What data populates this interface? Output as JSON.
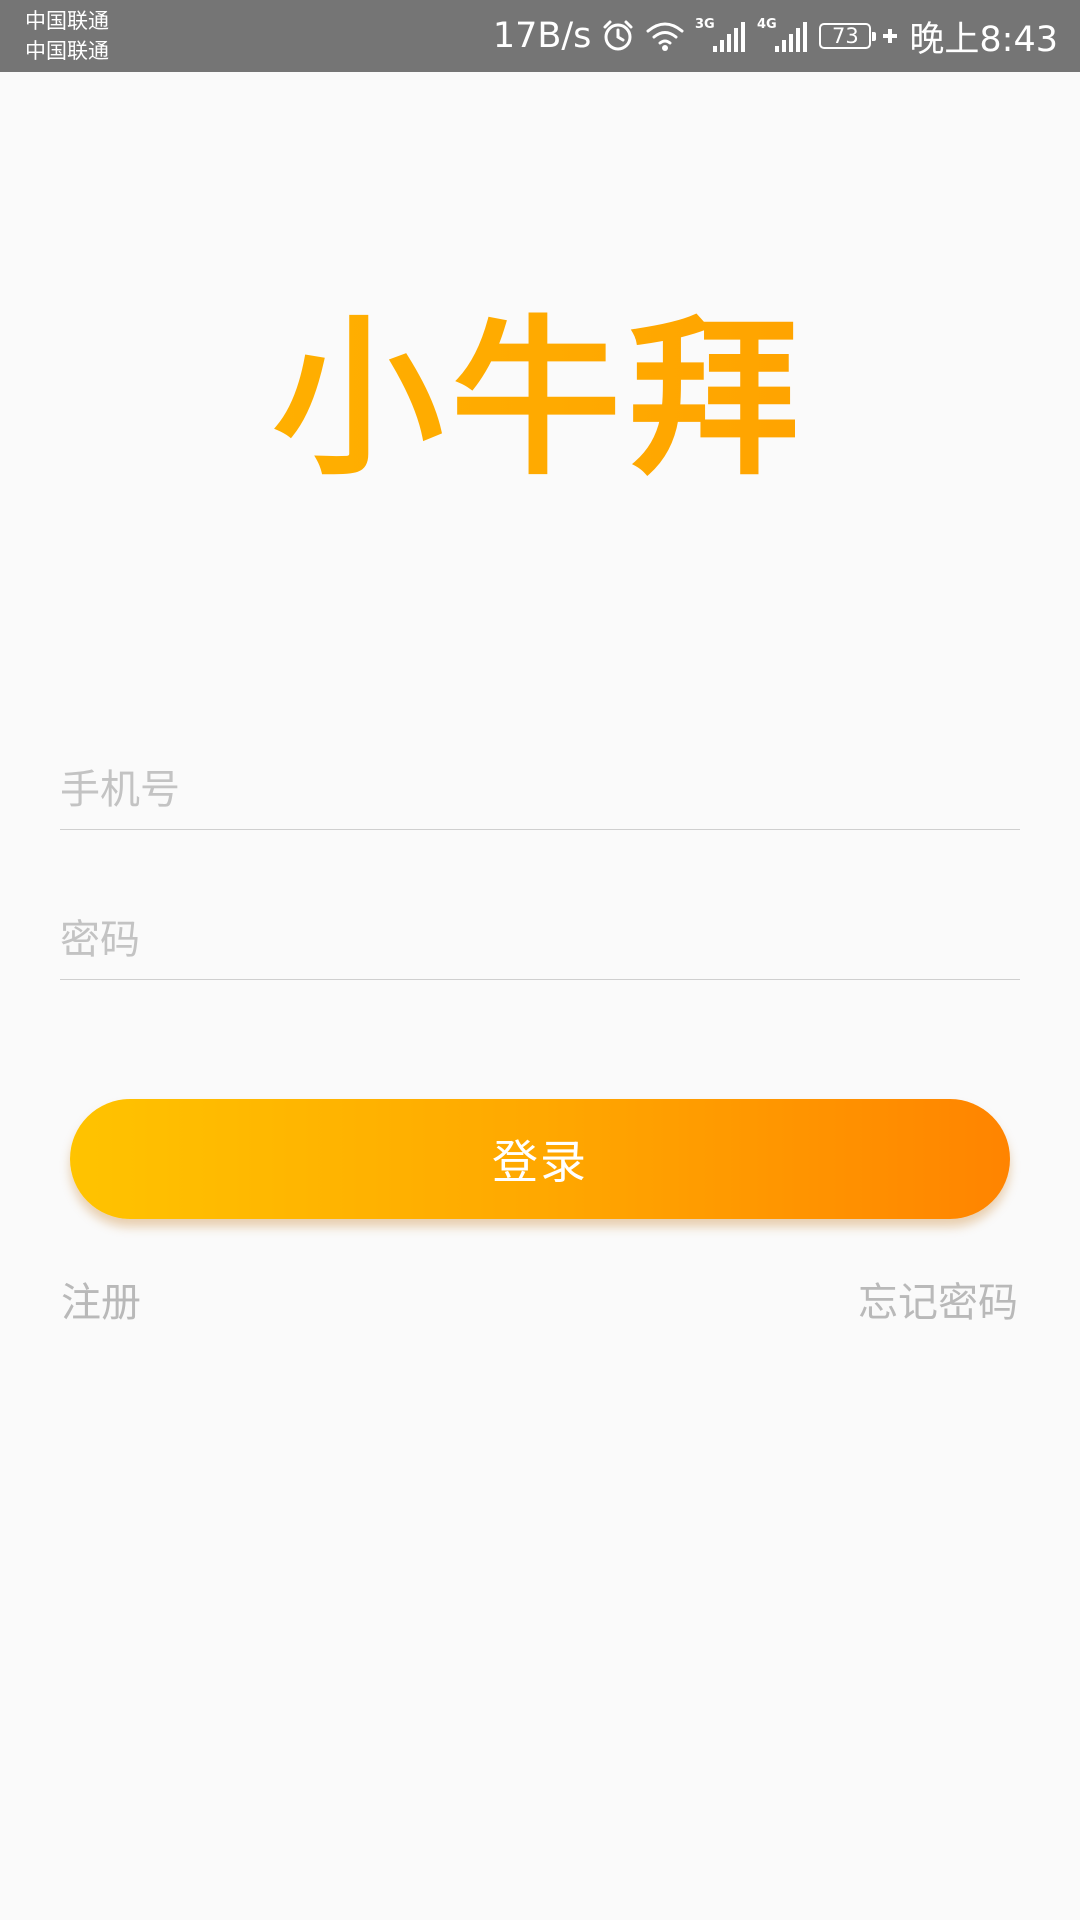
{
  "status_bar": {
    "carrier_1": "中国联通",
    "carrier_2": "中国联通",
    "network_speed": "17B/s",
    "signal_1_type": "3G",
    "signal_2_type": "4G",
    "battery_level": "73",
    "time": "晚上8:43",
    "icons": [
      "alarm-icon",
      "wifi-icon",
      "signal-3g-icon",
      "signal-4g-icon",
      "battery-icon",
      "charging-icon"
    ]
  },
  "logo": {
    "text": "小牛拜",
    "color": "#ffaa00"
  },
  "form": {
    "phone_placeholder": "手机号",
    "password_placeholder": "密码",
    "login_label": "登录"
  },
  "links": {
    "register": "注册",
    "forgot_password": "忘记密码"
  },
  "colors": {
    "button_gradient_start": "#ffc300",
    "button_gradient_end": "#ff8400",
    "status_bar": "#757575",
    "background": "#fafafa"
  }
}
